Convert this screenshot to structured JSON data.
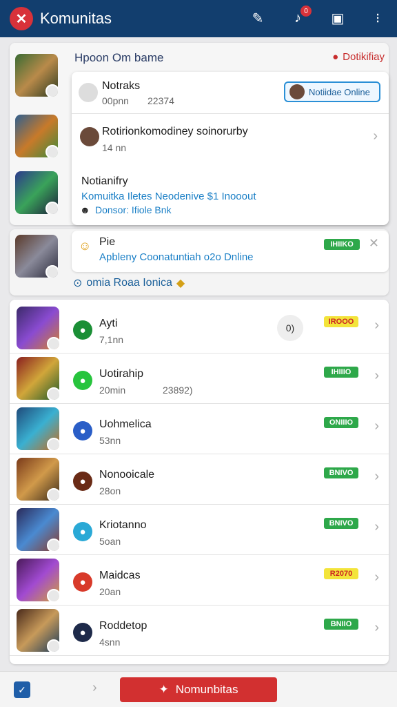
{
  "app": {
    "title": "Komunitas"
  },
  "section": {
    "header": "Hpoon Om bame",
    "link": "Dotikifiay"
  },
  "notifications": {
    "top": {
      "title": "Notraks",
      "time": "00pnn",
      "count": "22374",
      "online_chip": "Notiidae Online"
    },
    "second": {
      "title": "Rotirionkomodiney soinorurby",
      "time": "14 nn"
    },
    "third": {
      "title": "Notianifry",
      "blue_line": "Komuitka Iletes Neodenive $1 Inooout",
      "sub_line": "Donsor: Ifiole Bnk"
    }
  },
  "pie_card": {
    "title": "Pie",
    "sub": "Apbleny Coonatuntiah o2o Dnline",
    "pill": "IHIIKO"
  },
  "online_row": {
    "text": "omia Roaa Ionica"
  },
  "list": [
    {
      "title": "Ayti",
      "time": "7,1nn",
      "pill": "IROOO",
      "pill_color": "yellow",
      "icon_color": "#1b8f36",
      "extra": "0)"
    },
    {
      "title": "Uotirahip",
      "time": "20min",
      "count": "23892)",
      "pill": "IHIIIO",
      "pill_color": "green",
      "icon_color": "#27c43d"
    },
    {
      "title": "Uohmelica",
      "time": "53nn",
      "pill": "ONIIIO",
      "pill_color": "green",
      "icon_color": "#2a5ec7"
    },
    {
      "title": "Nonooicale",
      "time": "28on",
      "pill": "BNIVO",
      "pill_color": "green",
      "icon_color": "#6a2b16"
    },
    {
      "title": "Kriotanno",
      "time": "5oan",
      "pill": "BNIVO",
      "pill_color": "green",
      "icon_color": "#2aa9d6"
    },
    {
      "title": "Maidcas",
      "time": "20an",
      "pill": "R2070",
      "pill_color": "yellow",
      "icon_color": "#d83a2a"
    },
    {
      "title": "Roddetop",
      "time": "4snn",
      "pill": "BNIIO",
      "pill_color": "green",
      "icon_color": "#1e2a4a"
    }
  ],
  "bottom": {
    "cta": "Nomunbitas"
  },
  "colors": {
    "brand": "#123e6e",
    "accent": "#d23030",
    "link": "#1a7fc6"
  }
}
